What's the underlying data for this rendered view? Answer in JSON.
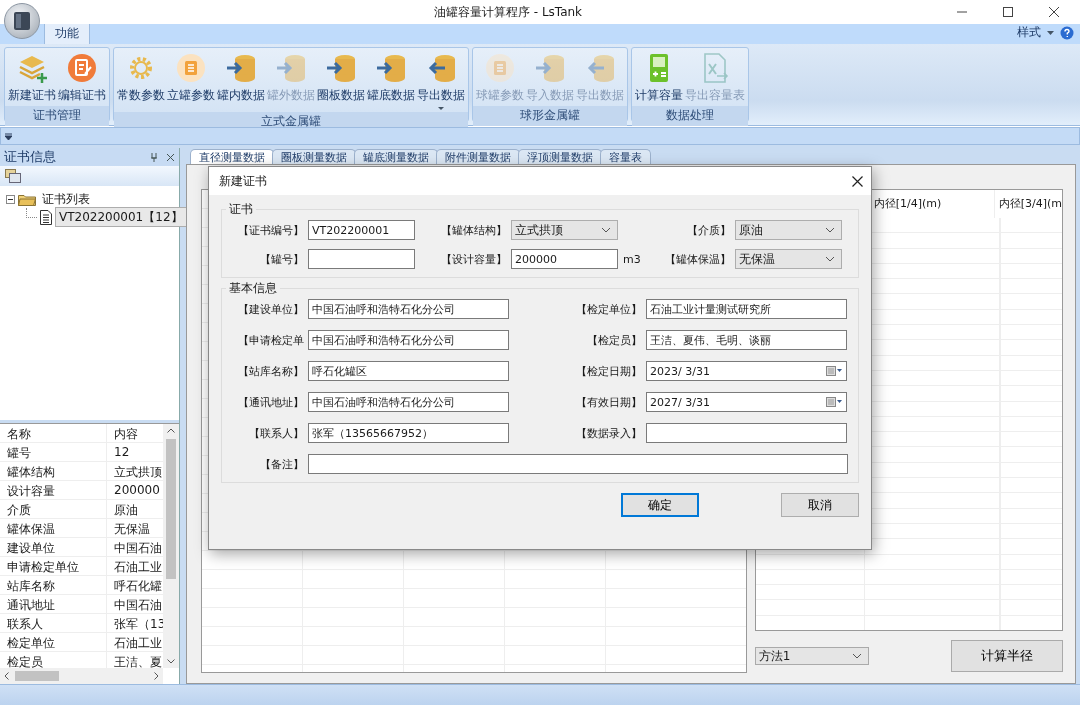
{
  "window": {
    "title": "油罐容量计算程序 - LsTank"
  },
  "ribbon": {
    "tabs": [
      {
        "label": "功能",
        "selected": true
      }
    ],
    "style_menu": "样式",
    "groups": [
      {
        "label": "证书管理",
        "buttons": [
          {
            "label": "新建证书",
            "kind": "layers-add",
            "disabled": false
          },
          {
            "label": "编辑证书",
            "kind": "edit",
            "disabled": false
          }
        ]
      },
      {
        "label": "立式金属罐",
        "buttons": [
          {
            "label": "常数参数",
            "kind": "gear",
            "disabled": false
          },
          {
            "label": "立罐参数",
            "kind": "list",
            "disabled": false
          },
          {
            "label": "罐内数据",
            "kind": "db-in",
            "disabled": false
          },
          {
            "label": "罐外数据",
            "kind": "db-in",
            "disabled": true
          },
          {
            "label": "圈板数据",
            "kind": "db-in",
            "disabled": false
          },
          {
            "label": "罐底数据",
            "kind": "db-in",
            "disabled": false
          },
          {
            "label": "导出数据",
            "kind": "db-out",
            "disabled": false,
            "dropdown": true
          }
        ]
      },
      {
        "label": "球形金属罐",
        "buttons": [
          {
            "label": "球罐参数",
            "kind": "list",
            "disabled": true
          },
          {
            "label": "导入数据",
            "kind": "db-in",
            "disabled": true
          },
          {
            "label": "导出数据",
            "kind": "db-out",
            "disabled": true
          }
        ]
      },
      {
        "label": "数据处理",
        "buttons": [
          {
            "label": "计算容量",
            "kind": "calculator",
            "disabled": false
          },
          {
            "label": "导出容量表",
            "kind": "excel-export",
            "disabled": true
          }
        ]
      }
    ]
  },
  "left_panel": {
    "title": "证书信息",
    "tree": [
      {
        "label": "证书列表",
        "expanded": true,
        "children": [
          {
            "label": "VT202200001【12】",
            "selected": true
          }
        ]
      }
    ],
    "properties": {
      "columns": [
        "名称",
        "内容"
      ],
      "rows": [
        {
          "name": "罐号",
          "value": "12"
        },
        {
          "name": "罐体结构",
          "value": "立式拱顶"
        },
        {
          "name": "设计容量",
          "value": "200000"
        },
        {
          "name": "介质",
          "value": "原油"
        },
        {
          "name": "罐体保温",
          "value": "无保温"
        },
        {
          "name": "建设单位",
          "value": "中国石油"
        },
        {
          "name": "申请检定单位",
          "value": "石油工业"
        },
        {
          "name": "站库名称",
          "value": "呼石化罐"
        },
        {
          "name": "通讯地址",
          "value": "中国石油"
        },
        {
          "name": "联系人",
          "value": "张军（13"
        },
        {
          "name": "检定单位",
          "value": "石油工业"
        },
        {
          "name": "检定员",
          "value": "王洁、夏"
        }
      ]
    }
  },
  "doc_tabs": [
    {
      "label": "直径测量数据",
      "selected": true
    },
    {
      "label": "圈板测量数据",
      "selected": false
    },
    {
      "label": "罐底测量数据",
      "selected": false
    },
    {
      "label": "附件测量数据",
      "selected": false
    },
    {
      "label": "浮顶测量数据",
      "selected": false
    },
    {
      "label": "容量表",
      "selected": false
    }
  ],
  "right_grid": {
    "columns": [
      "内径[1/4](m)",
      "内径[3/4](m"
    ]
  },
  "method_select": {
    "value": "方法1"
  },
  "calc_button": "计算半径",
  "dialog": {
    "title": "新建证书",
    "section_1": {
      "label": "证书",
      "fields": [
        {
          "label": "【证书编号】",
          "kind": "text",
          "value": "VT202200001"
        },
        {
          "label": "【罐体结构】",
          "kind": "select",
          "value": "立式拱顶"
        },
        {
          "label": "【介质】",
          "kind": "select",
          "value": "原油"
        },
        {
          "label": "【罐号】",
          "kind": "text"
        },
        {
          "label": "【设计容量】",
          "kind": "text",
          "value": "200000",
          "unit": "m3"
        },
        {
          "label": "【罐体保温】",
          "kind": "select",
          "value": "无保温"
        }
      ]
    },
    "section_2": {
      "label": "基本信息",
      "fields": [
        {
          "label": "【建设单位】",
          "kind": "text",
          "value": "中国石油呼和浩特石化分公司"
        },
        {
          "label": "【检定单位】",
          "kind": "text",
          "value": "石油工业计量测试研究所"
        },
        {
          "label": "【申请检定单",
          "kind": "text",
          "value": "中国石油呼和浩特石化分公司"
        },
        {
          "label": "【检定员】",
          "kind": "text",
          "value": "王洁、夏伟、毛明、谈丽"
        },
        {
          "label": "【站库名称】",
          "kind": "text",
          "value": "呼石化罐区"
        },
        {
          "label": "【检定日期】",
          "kind": "date",
          "value": "2023/  3/31"
        },
        {
          "label": "【通讯地址】",
          "kind": "text",
          "value": "中国石油呼和浩特石化分公司"
        },
        {
          "label": "【有效日期】",
          "kind": "date",
          "value": "2027/  3/31"
        },
        {
          "label": "【联系人】",
          "kind": "text",
          "value": "张军（13565667952）"
        },
        {
          "label": "【数据录入】",
          "kind": "text"
        }
      ],
      "remarks": {
        "label": "【备注】"
      }
    },
    "buttons": [
      {
        "label": "确定",
        "default": true
      },
      {
        "label": "取消",
        "default": false
      }
    ]
  }
}
